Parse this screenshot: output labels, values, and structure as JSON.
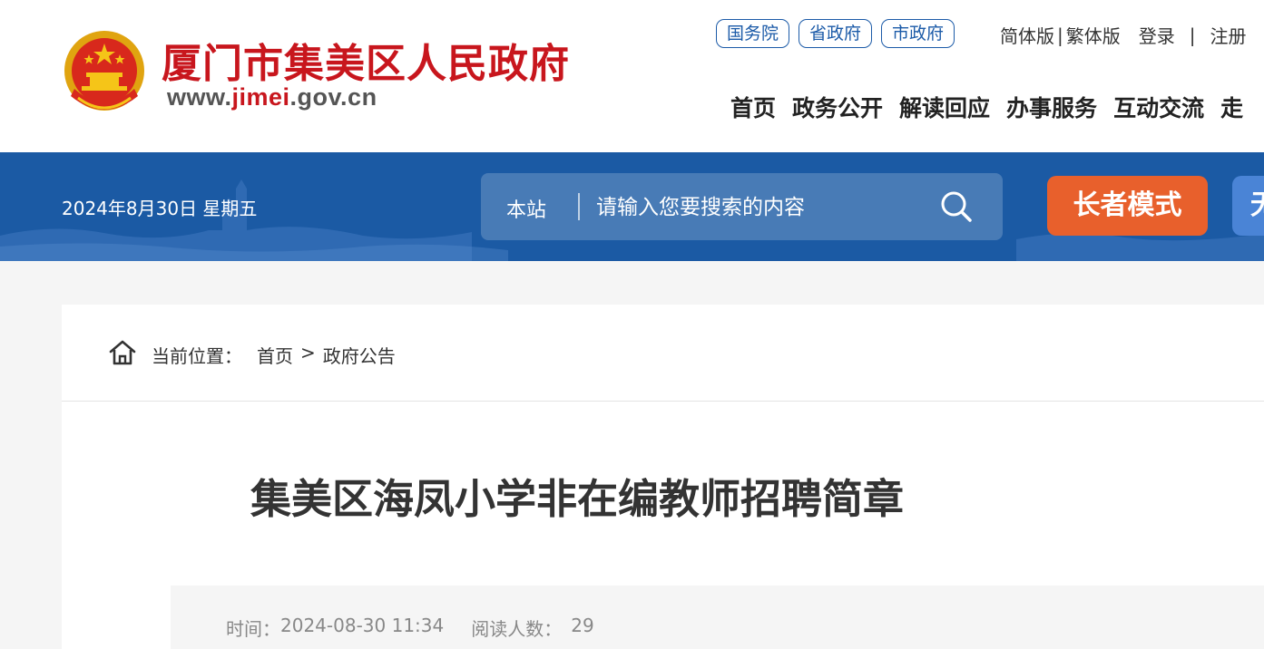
{
  "header": {
    "site_title": "厦门市集美区人民政府",
    "url": {
      "prefix": "www.",
      "highlight": "jimei",
      "suffix": ".gov.cn"
    },
    "gov_links": [
      "国务院",
      "省政府",
      "市政府"
    ],
    "top_links": {
      "simplified": "简体版",
      "sep1": "|",
      "traditional": "繁体版",
      "login": "登录",
      "sep2": "|",
      "register": "注册"
    },
    "nav": [
      "首页",
      "政务公开",
      "解读回应",
      "办事服务",
      "互动交流",
      "走"
    ]
  },
  "banner": {
    "date": "2024年8月30日 星期五",
    "search": {
      "scope": "本站",
      "placeholder": "请输入您要搜索的内容"
    },
    "elder_mode": "长者模式",
    "accessibility": "无"
  },
  "breadcrumb": {
    "label": "当前位置：",
    "home": "首页",
    "arrow": ">",
    "current": "政府公告"
  },
  "article": {
    "title": "集美区海凤小学非在编教师招聘简章",
    "time_label": "时间：",
    "time_value": "2024-08-30 11:34",
    "views_label": "阅读人数：",
    "views_value": "29"
  },
  "colors": {
    "brand_red": "#c8161d",
    "banner_blue": "#1b5aa4",
    "elder_orange": "#e8602c",
    "link_blue": "#1c5ba8"
  },
  "icons": [
    "national-emblem-icon",
    "search-icon",
    "home-icon"
  ]
}
